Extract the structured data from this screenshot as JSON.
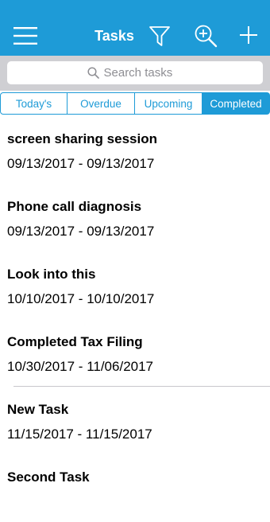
{
  "navbar": {
    "title": "Tasks",
    "menu_icon": "hamburger-menu-icon",
    "filter_icon": "filter-icon",
    "zoom_icon": "zoom-search-icon",
    "add_icon": "plus-icon",
    "accent_color": "#1e9bd7"
  },
  "search": {
    "placeholder": "Search tasks",
    "value": ""
  },
  "tabs": [
    {
      "label": "Today's",
      "active": false
    },
    {
      "label": "Overdue",
      "active": false
    },
    {
      "label": "Upcoming",
      "active": false
    },
    {
      "label": "Completed",
      "active": true
    }
  ],
  "tasks": [
    {
      "title": "screen sharing session",
      "dates": "09/13/2017 - 09/13/2017"
    },
    {
      "title": "Phone call diagnosis",
      "dates": "09/13/2017 - 09/13/2017"
    },
    {
      "title": "Look into this",
      "dates": "10/10/2017 - 10/10/2017"
    },
    {
      "title": "Completed Tax Filing",
      "dates": "10/30/2017 - 11/06/2017"
    },
    {
      "title": "New Task",
      "dates": "11/15/2017 - 11/15/2017"
    },
    {
      "title": "Second Task",
      "dates": ""
    }
  ]
}
